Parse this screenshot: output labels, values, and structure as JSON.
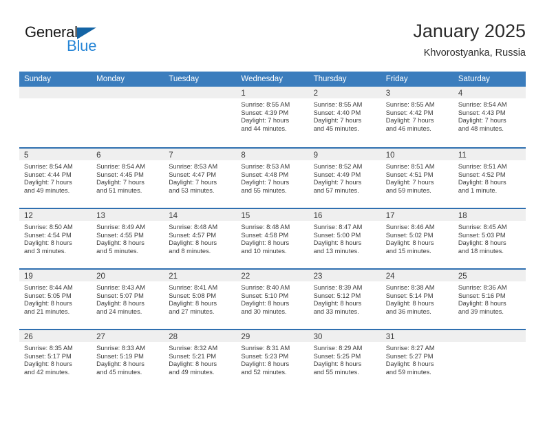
{
  "logo": {
    "word_top": "General",
    "word_bottom": "Blue",
    "triangle_color": "#1464a5",
    "blue_color": "#2484d6"
  },
  "header": {
    "title": "January 2025",
    "subtitle": "Khvorostyanka, Russia"
  },
  "colors": {
    "header_blue": "#3b7dbd",
    "row_divider_blue": "#2f6fb0",
    "day_band_gray": "#efefef",
    "text": "#3a3a3a"
  },
  "weekdays": [
    "Sunday",
    "Monday",
    "Tuesday",
    "Wednesday",
    "Thursday",
    "Friday",
    "Saturday"
  ],
  "weeks": [
    [
      {
        "day": "",
        "lines": []
      },
      {
        "day": "",
        "lines": []
      },
      {
        "day": "",
        "lines": []
      },
      {
        "day": "1",
        "lines": [
          "Sunrise: 8:55 AM",
          "Sunset: 4:39 PM",
          "Daylight: 7 hours",
          "and 44 minutes."
        ]
      },
      {
        "day": "2",
        "lines": [
          "Sunrise: 8:55 AM",
          "Sunset: 4:40 PM",
          "Daylight: 7 hours",
          "and 45 minutes."
        ]
      },
      {
        "day": "3",
        "lines": [
          "Sunrise: 8:55 AM",
          "Sunset: 4:42 PM",
          "Daylight: 7 hours",
          "and 46 minutes."
        ]
      },
      {
        "day": "4",
        "lines": [
          "Sunrise: 8:54 AM",
          "Sunset: 4:43 PM",
          "Daylight: 7 hours",
          "and 48 minutes."
        ]
      }
    ],
    [
      {
        "day": "5",
        "lines": [
          "Sunrise: 8:54 AM",
          "Sunset: 4:44 PM",
          "Daylight: 7 hours",
          "and 49 minutes."
        ]
      },
      {
        "day": "6",
        "lines": [
          "Sunrise: 8:54 AM",
          "Sunset: 4:45 PM",
          "Daylight: 7 hours",
          "and 51 minutes."
        ]
      },
      {
        "day": "7",
        "lines": [
          "Sunrise: 8:53 AM",
          "Sunset: 4:47 PM",
          "Daylight: 7 hours",
          "and 53 minutes."
        ]
      },
      {
        "day": "8",
        "lines": [
          "Sunrise: 8:53 AM",
          "Sunset: 4:48 PM",
          "Daylight: 7 hours",
          "and 55 minutes."
        ]
      },
      {
        "day": "9",
        "lines": [
          "Sunrise: 8:52 AM",
          "Sunset: 4:49 PM",
          "Daylight: 7 hours",
          "and 57 minutes."
        ]
      },
      {
        "day": "10",
        "lines": [
          "Sunrise: 8:51 AM",
          "Sunset: 4:51 PM",
          "Daylight: 7 hours",
          "and 59 minutes."
        ]
      },
      {
        "day": "11",
        "lines": [
          "Sunrise: 8:51 AM",
          "Sunset: 4:52 PM",
          "Daylight: 8 hours",
          "and 1 minute."
        ]
      }
    ],
    [
      {
        "day": "12",
        "lines": [
          "Sunrise: 8:50 AM",
          "Sunset: 4:54 PM",
          "Daylight: 8 hours",
          "and 3 minutes."
        ]
      },
      {
        "day": "13",
        "lines": [
          "Sunrise: 8:49 AM",
          "Sunset: 4:55 PM",
          "Daylight: 8 hours",
          "and 5 minutes."
        ]
      },
      {
        "day": "14",
        "lines": [
          "Sunrise: 8:48 AM",
          "Sunset: 4:57 PM",
          "Daylight: 8 hours",
          "and 8 minutes."
        ]
      },
      {
        "day": "15",
        "lines": [
          "Sunrise: 8:48 AM",
          "Sunset: 4:58 PM",
          "Daylight: 8 hours",
          "and 10 minutes."
        ]
      },
      {
        "day": "16",
        "lines": [
          "Sunrise: 8:47 AM",
          "Sunset: 5:00 PM",
          "Daylight: 8 hours",
          "and 13 minutes."
        ]
      },
      {
        "day": "17",
        "lines": [
          "Sunrise: 8:46 AM",
          "Sunset: 5:02 PM",
          "Daylight: 8 hours",
          "and 15 minutes."
        ]
      },
      {
        "day": "18",
        "lines": [
          "Sunrise: 8:45 AM",
          "Sunset: 5:03 PM",
          "Daylight: 8 hours",
          "and 18 minutes."
        ]
      }
    ],
    [
      {
        "day": "19",
        "lines": [
          "Sunrise: 8:44 AM",
          "Sunset: 5:05 PM",
          "Daylight: 8 hours",
          "and 21 minutes."
        ]
      },
      {
        "day": "20",
        "lines": [
          "Sunrise: 8:43 AM",
          "Sunset: 5:07 PM",
          "Daylight: 8 hours",
          "and 24 minutes."
        ]
      },
      {
        "day": "21",
        "lines": [
          "Sunrise: 8:41 AM",
          "Sunset: 5:08 PM",
          "Daylight: 8 hours",
          "and 27 minutes."
        ]
      },
      {
        "day": "22",
        "lines": [
          "Sunrise: 8:40 AM",
          "Sunset: 5:10 PM",
          "Daylight: 8 hours",
          "and 30 minutes."
        ]
      },
      {
        "day": "23",
        "lines": [
          "Sunrise: 8:39 AM",
          "Sunset: 5:12 PM",
          "Daylight: 8 hours",
          "and 33 minutes."
        ]
      },
      {
        "day": "24",
        "lines": [
          "Sunrise: 8:38 AM",
          "Sunset: 5:14 PM",
          "Daylight: 8 hours",
          "and 36 minutes."
        ]
      },
      {
        "day": "25",
        "lines": [
          "Sunrise: 8:36 AM",
          "Sunset: 5:16 PM",
          "Daylight: 8 hours",
          "and 39 minutes."
        ]
      }
    ],
    [
      {
        "day": "26",
        "lines": [
          "Sunrise: 8:35 AM",
          "Sunset: 5:17 PM",
          "Daylight: 8 hours",
          "and 42 minutes."
        ]
      },
      {
        "day": "27",
        "lines": [
          "Sunrise: 8:33 AM",
          "Sunset: 5:19 PM",
          "Daylight: 8 hours",
          "and 45 minutes."
        ]
      },
      {
        "day": "28",
        "lines": [
          "Sunrise: 8:32 AM",
          "Sunset: 5:21 PM",
          "Daylight: 8 hours",
          "and 49 minutes."
        ]
      },
      {
        "day": "29",
        "lines": [
          "Sunrise: 8:31 AM",
          "Sunset: 5:23 PM",
          "Daylight: 8 hours",
          "and 52 minutes."
        ]
      },
      {
        "day": "30",
        "lines": [
          "Sunrise: 8:29 AM",
          "Sunset: 5:25 PM",
          "Daylight: 8 hours",
          "and 55 minutes."
        ]
      },
      {
        "day": "31",
        "lines": [
          "Sunrise: 8:27 AM",
          "Sunset: 5:27 PM",
          "Daylight: 8 hours",
          "and 59 minutes."
        ]
      },
      {
        "day": "",
        "lines": []
      }
    ]
  ]
}
